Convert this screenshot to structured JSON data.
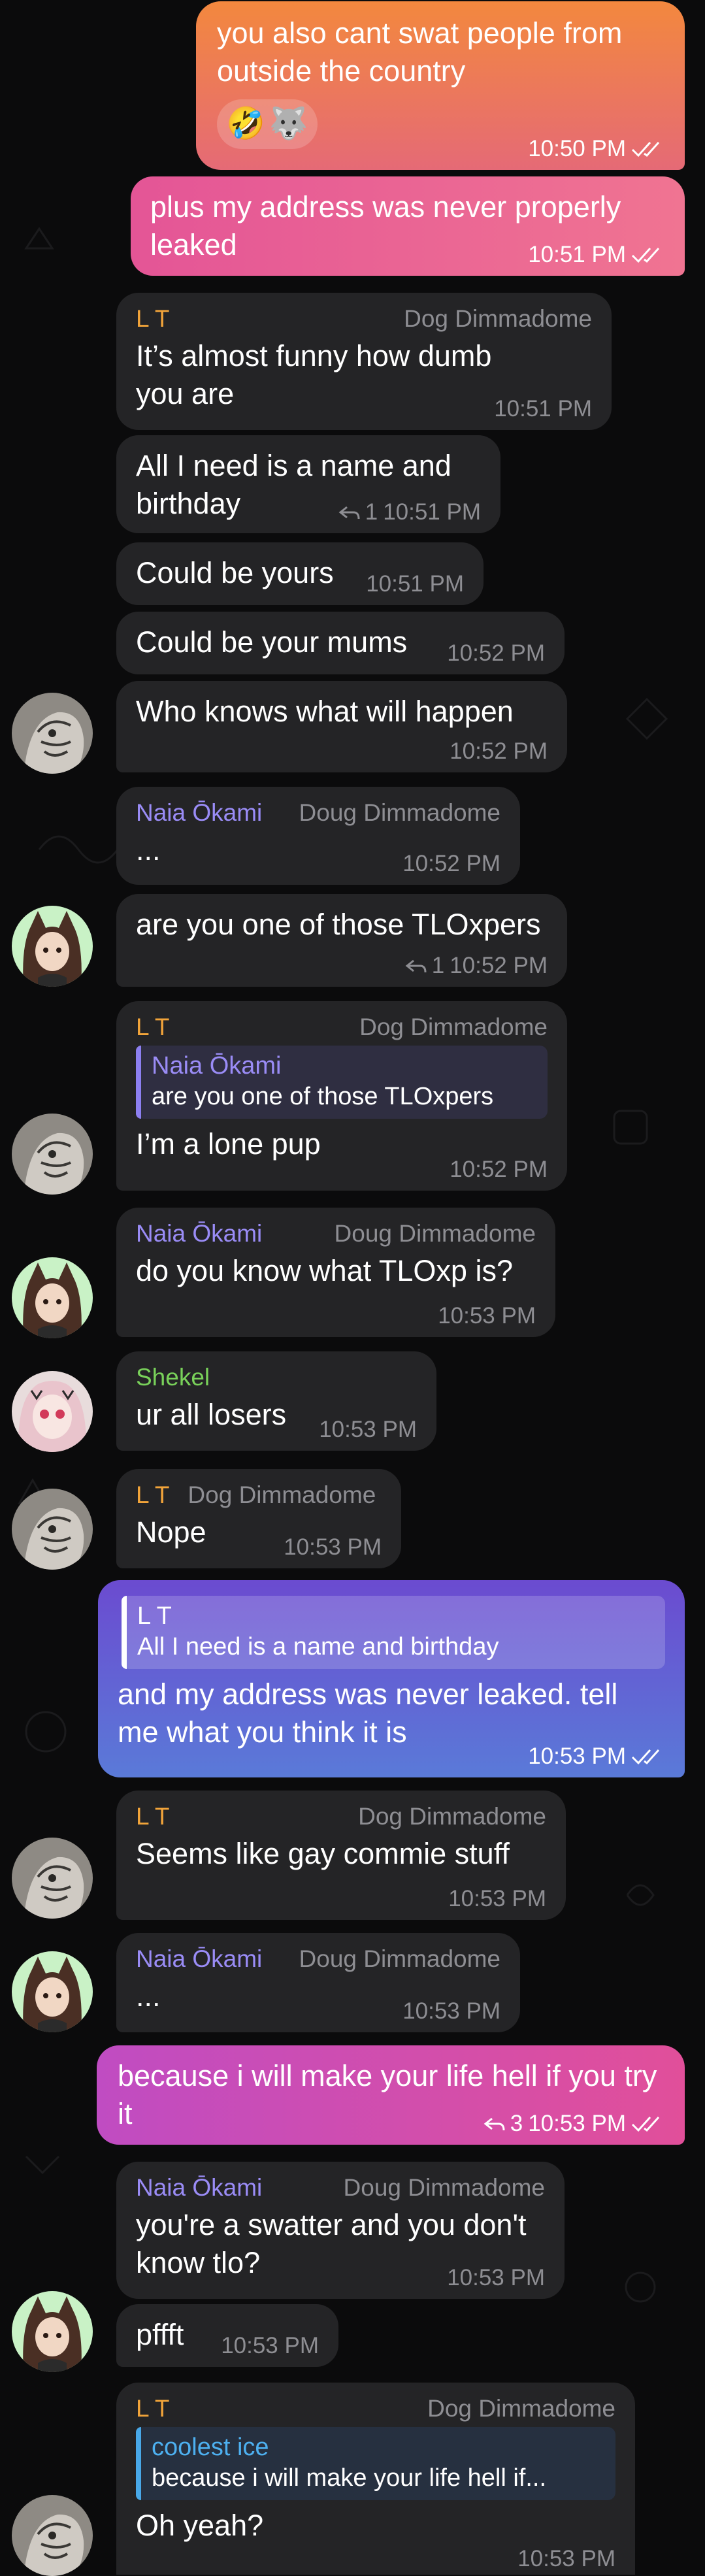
{
  "theme": {
    "background": "#0b0b0c",
    "incoming_bubble": "#242426",
    "name_colors": {
      "lt": "#f2a43a",
      "naia": "#9a8cf6",
      "shekel": "#79d15a",
      "ice": "#4db0f0"
    }
  },
  "messages": [
    {
      "id": "m1",
      "dir": "out",
      "text": "you also cant swat people from outside the country",
      "reactions": [
        "🤣",
        "🐺"
      ],
      "time": "10:50 PM",
      "read": true
    },
    {
      "id": "m2",
      "dir": "out",
      "text": "plus my address was never properly leaked",
      "time": "10:51 PM",
      "read": true
    },
    {
      "id": "m3",
      "dir": "in",
      "sender": "L T",
      "rank": "Dog Dimmadome",
      "text": "It’s almost funny how dumb you are",
      "time": "10:51 PM"
    },
    {
      "id": "m4",
      "dir": "in",
      "text": "All I need is a name and birthday",
      "reply_count": "1",
      "time": "10:51 PM"
    },
    {
      "id": "m5",
      "dir": "in",
      "text": "Could be yours",
      "time": "10:51 PM"
    },
    {
      "id": "m6",
      "dir": "in",
      "text": "Could be your mums",
      "time": "10:52 PM"
    },
    {
      "id": "m7",
      "dir": "in",
      "text": "Who knows what will happen",
      "time": "10:52 PM",
      "avatar": "lt-avatar"
    },
    {
      "id": "m8",
      "dir": "in",
      "sender": "Naia Ōkami",
      "rank": "Doug Dimmadome",
      "text": "...",
      "time": "10:52 PM"
    },
    {
      "id": "m9",
      "dir": "in",
      "text": "are you one of those TLOxpers",
      "reply_count": "1",
      "time": "10:52 PM",
      "avatar": "naia-avatar"
    },
    {
      "id": "m10",
      "dir": "in",
      "sender": "L T",
      "rank": "Dog Dimmadome",
      "quote": {
        "name": "Naia Ōkami",
        "text": "are you one of those TLOxpers"
      },
      "text": "I’m a lone pup",
      "time": "10:52 PM",
      "avatar": "lt-avatar"
    },
    {
      "id": "m11",
      "dir": "in",
      "sender": "Naia Ōkami",
      "rank": "Doug Dimmadome",
      "text": "do you know what TLOxp is?",
      "time": "10:53 PM",
      "avatar": "naia-avatar"
    },
    {
      "id": "m12",
      "dir": "in",
      "sender": "Shekel",
      "text": "ur all losers",
      "time": "10:53 PM",
      "avatar": "shekel-avatar"
    },
    {
      "id": "m13",
      "dir": "in",
      "sender": "L T",
      "rank": "Dog Dimmadome",
      "text": "Nope",
      "time": "10:53 PM",
      "avatar": "lt-avatar"
    },
    {
      "id": "m14",
      "dir": "out",
      "quote": {
        "name": "L T",
        "text": "All I need is a name and birthday"
      },
      "text": "and my address was never leaked. tell me what you think it is",
      "time": "10:53 PM",
      "read": true
    },
    {
      "id": "m15",
      "dir": "in",
      "sender": "L T",
      "rank": "Dog Dimmadome",
      "text": "Seems like gay commie stuff",
      "time": "10:53 PM",
      "avatar": "lt-avatar"
    },
    {
      "id": "m16",
      "dir": "in",
      "sender": "Naia Ōkami",
      "rank": "Doug Dimmadome",
      "text": "...",
      "time": "10:53 PM",
      "avatar": "naia-avatar"
    },
    {
      "id": "m17",
      "dir": "out",
      "text": "because i will make your life hell if you try it",
      "reply_count": "3",
      "time": "10:53 PM",
      "read": true
    },
    {
      "id": "m18",
      "dir": "in",
      "sender": "Naia Ōkami",
      "rank": "Doug Dimmadome",
      "text": "you're a swatter and you don't know tlo?",
      "time": "10:53 PM"
    },
    {
      "id": "m19",
      "dir": "in",
      "text": "pffft",
      "time": "10:53 PM",
      "avatar": "naia-avatar"
    },
    {
      "id": "m20",
      "dir": "in",
      "sender": "L T",
      "rank": "Dog Dimmadome",
      "quote": {
        "name": "coolest ice",
        "text": "because i will make your life hell if..."
      },
      "text": "Oh yeah?",
      "time": "10:53 PM",
      "avatar": "lt-avatar"
    }
  ]
}
